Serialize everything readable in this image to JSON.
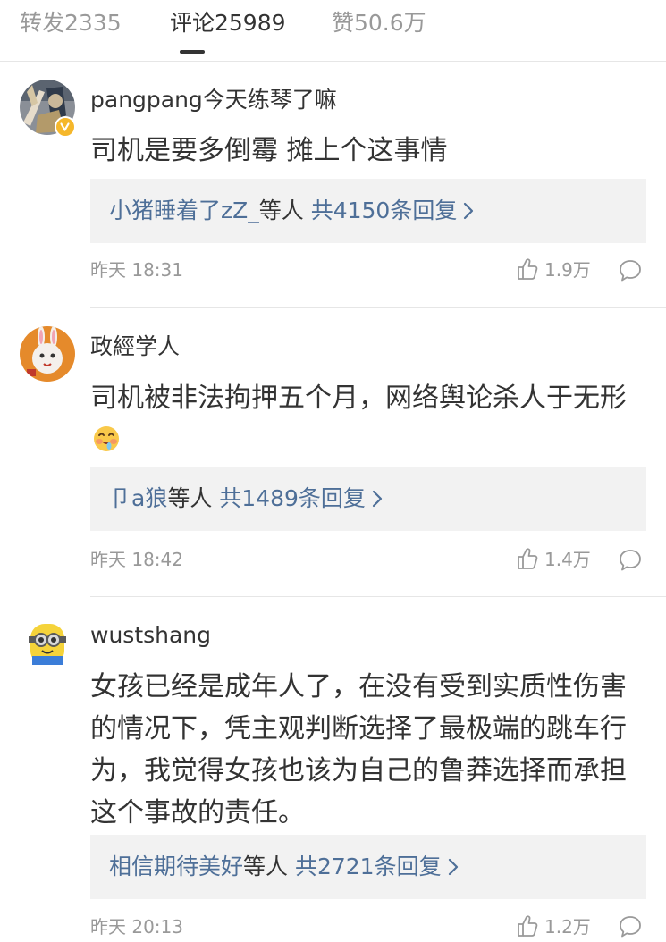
{
  "tabs": {
    "reposts": "转发2335",
    "comments": "评论25989",
    "likes": "赞50.6万",
    "active": "comments"
  },
  "comments": [
    {
      "username": "pangpang今天练琴了嘛",
      "verified": true,
      "content": "司机是要多倒霉 摊上个这事情",
      "reply_users": "小猪睡着了zZ_",
      "reply_mid": "等人 ",
      "reply_total": "共4150条回复",
      "time": "昨天 18:31",
      "likes": "1.9万"
    },
    {
      "username": "政經学人",
      "verified": false,
      "content": "司机被非法拘押五个月，网络舆论杀人于无形",
      "content_emoji": "drooling-face-emoji",
      "reply_users": "卩a狼",
      "reply_mid": "等人 ",
      "reply_total": "共1489条回复",
      "time": "昨天 18:42",
      "likes": "1.4万"
    },
    {
      "username": "wustshang",
      "verified": false,
      "content": "女孩已经是成年人了，在没有受到实质性伤害的情况下，凭主观判断选择了最极端的跳车行为，我觉得女孩也该为自己的鲁莽选择而承担这个事故的责任。",
      "reply_users": "相信期待美好",
      "reply_mid": "等人 ",
      "reply_total": "共2721条回复",
      "time": "昨天 20:13",
      "likes": "1.2万"
    }
  ],
  "icons": {
    "like": "thumbs-up-icon",
    "reply": "speech-bubble-icon",
    "more": "chevron-right-icon",
    "verified": "verified-badge-icon"
  },
  "colors": {
    "link": "#4e6f98",
    "text": "#333333",
    "muted": "#999999",
    "reply_bg": "#f2f2f2",
    "verified": "#f5b72b"
  }
}
